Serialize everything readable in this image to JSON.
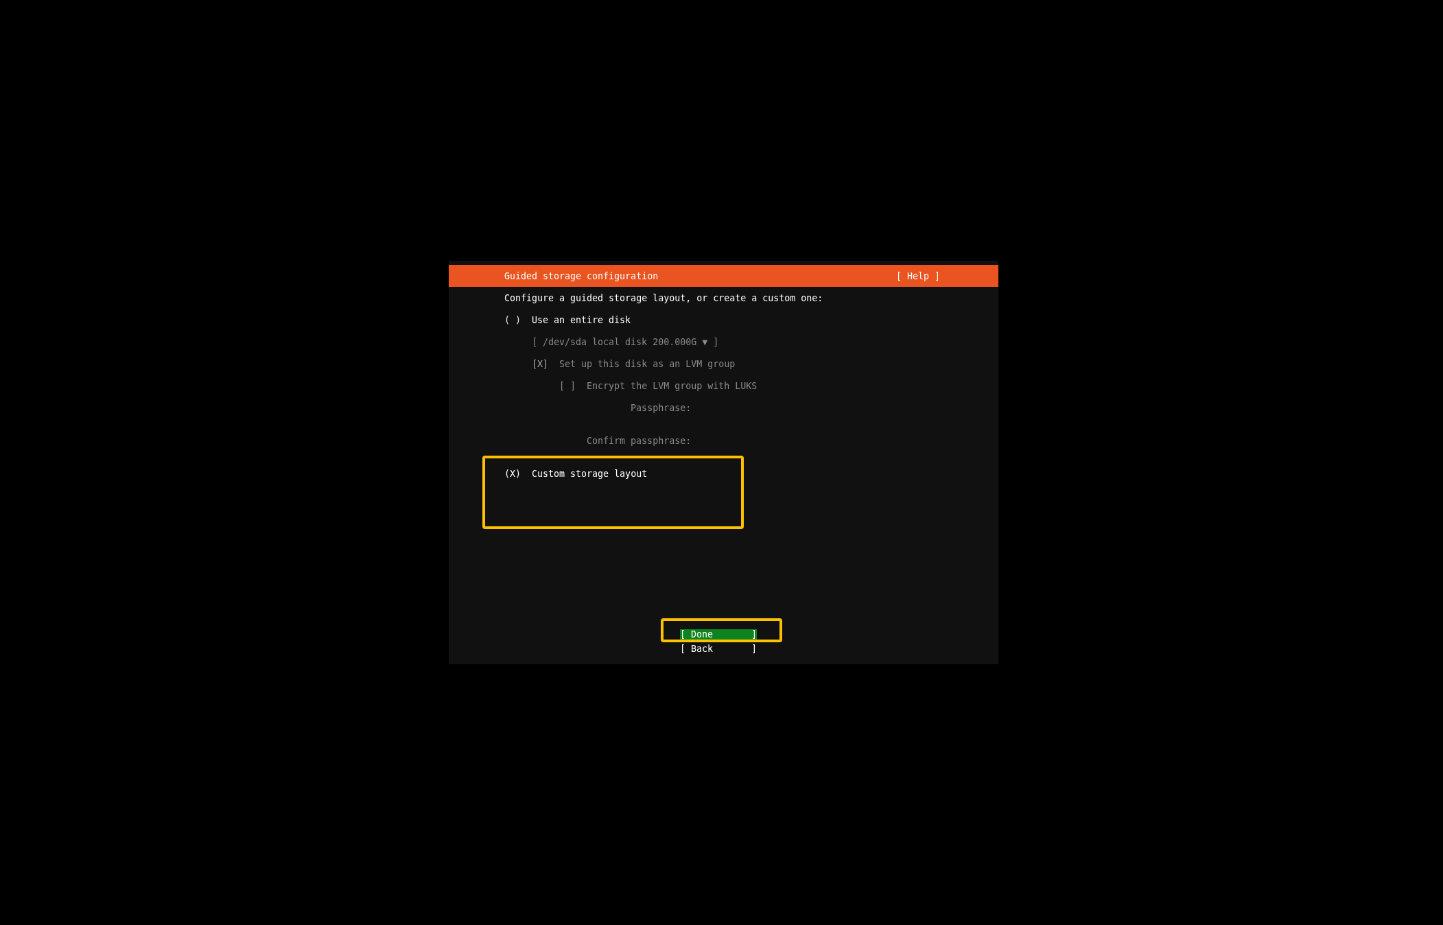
{
  "header": {
    "title": "Guided storage configuration",
    "help": "[ Help ]"
  },
  "intro": "Configure a guided storage layout, or create a custom one:",
  "options": [
    {
      "kind": "radio",
      "mark": "( )",
      "label": "Use an entire disk",
      "selected": false,
      "disabled": false,
      "children": [
        {
          "kind": "dropdown",
          "text": "[ /dev/sda local disk 200.000G ▼ ]",
          "disabled": true
        },
        {
          "kind": "checkbox",
          "mark": "[X]",
          "label": "Set up this disk as an LVM group",
          "checked": true,
          "disabled": true,
          "children": [
            {
              "kind": "checkbox",
              "mark": "[ ]",
              "label": "Encrypt the LVM group with LUKS",
              "checked": false,
              "disabled": true,
              "children": [
                {
                  "kind": "field",
                  "label": "Passphrase:",
                  "disabled": true
                },
                {
                  "kind": "field",
                  "label": "Confirm passphrase:",
                  "disabled": true
                }
              ]
            }
          ]
        }
      ]
    },
    {
      "kind": "radio",
      "mark": "(X)",
      "label": "Custom storage layout",
      "selected": true,
      "disabled": false
    }
  ],
  "buttons": [
    {
      "label": "[ Done       ]",
      "selected": true
    },
    {
      "label": "[ Back       ]",
      "selected": false
    }
  ]
}
